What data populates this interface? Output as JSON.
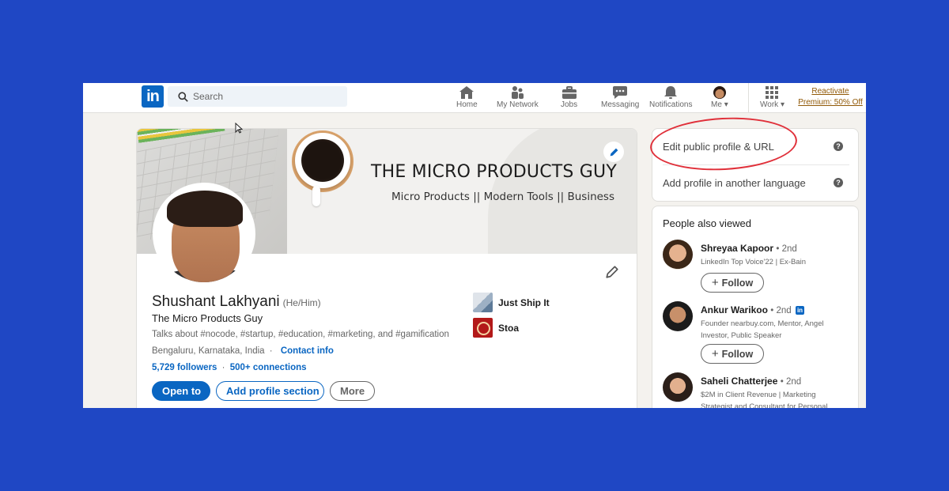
{
  "nav": {
    "logo": "in",
    "search_placeholder": "Search",
    "items": [
      {
        "label": "Home",
        "icon": "home-icon"
      },
      {
        "label": "My Network",
        "icon": "network-icon"
      },
      {
        "label": "Jobs",
        "icon": "briefcase-icon"
      },
      {
        "label": "Messaging",
        "icon": "messaging-icon"
      },
      {
        "label": "Notifications",
        "icon": "bell-icon"
      },
      {
        "label": "Me",
        "icon": "avatar-icon"
      },
      {
        "label": "Work",
        "icon": "grid-icon"
      }
    ],
    "premium_line1": "Reactivate",
    "premium_line2": "Premium: 50% Off"
  },
  "banner": {
    "title": "THE MICRO PRODUCTS GUY",
    "subtitle": "Micro Products || Modern Tools || Business"
  },
  "profile": {
    "name": "Shushant Lakhyani",
    "pronouns": "(He/Him)",
    "headline": "The Micro Products Guy",
    "talks_about": "Talks about #nocode, #startup, #education, #marketing, and #gamification",
    "location": "Bengaluru, Karnataka, India",
    "contact_info": "Contact info",
    "followers": "5,729 followers",
    "stats_sep": "·",
    "connections": "500+ connections",
    "buttons": {
      "open_to": "Open to",
      "add_section": "Add profile section",
      "more": "More"
    },
    "orgs": [
      {
        "name": "Just Ship It"
      },
      {
        "name": "Stoa"
      }
    ]
  },
  "sidebar": {
    "edit_public_profile": "Edit public profile & URL",
    "add_language": "Add profile in another language",
    "help_glyph": "?",
    "people_title": "People also viewed",
    "people": [
      {
        "name": "Shreyaa Kapoor",
        "degree": "• 2nd",
        "desc": "LinkedIn Top Voice'22 | Ex-Bain",
        "follow": "Follow"
      },
      {
        "name": "Ankur Warikoo",
        "degree": "• 2nd",
        "badge": "in",
        "desc": "Founder nearbuy.com, Mentor, Angel Investor, Public Speaker",
        "follow": "Follow"
      },
      {
        "name": "Saheli Chatterjee",
        "degree": "• 2nd",
        "desc": "$2M in Client Revenue | Marketing Strategist and Consultant for Personal"
      }
    ]
  },
  "colors": {
    "page_background": "#1f47c4",
    "linkedin_blue": "#0a66c2",
    "annotation_red": "#e0303a",
    "premium_gold": "#915907"
  }
}
